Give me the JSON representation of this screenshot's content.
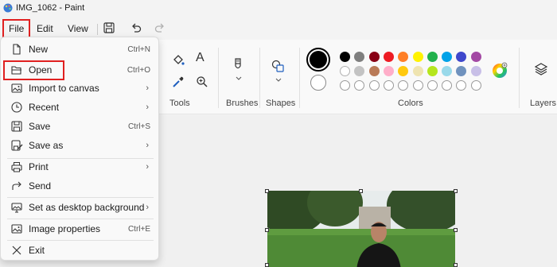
{
  "window": {
    "title": "IMG_1062 - Paint",
    "app_icon": "paint-palette-icon"
  },
  "menubar": {
    "file": "File",
    "edit": "Edit",
    "view": "View",
    "icons": [
      "save-icon",
      "undo-icon",
      "redo-icon"
    ]
  },
  "ribbon": {
    "tools_label": "Tools",
    "brushes_label": "Brushes",
    "shapes_label": "Shapes",
    "colors_label": "Colors",
    "layers_label": "Layers",
    "primary_color": "#000000",
    "secondary_color": "#ffffff",
    "palette_row1": [
      "#000000",
      "#7f7f7f",
      "#880015",
      "#ed1c24",
      "#ff7f27",
      "#fff200",
      "#22b14c",
      "#00a2e8",
      "#3f48cc",
      "#a349a4"
    ],
    "palette_row2": [
      "#ffffff",
      "#c3c3c3",
      "#b97a57",
      "#ffaec9",
      "#ffc90e",
      "#efe4b0",
      "#b5e61d",
      "#99d9ea",
      "#7092be",
      "#c8bfe7"
    ]
  },
  "file_menu": {
    "items": [
      {
        "label": "New",
        "shortcut": "Ctrl+N",
        "icon": "new-file-icon"
      },
      {
        "label": "Open",
        "shortcut": "Ctrl+O",
        "icon": "folder-open-icon"
      },
      {
        "label": "Import to canvas",
        "icon": "import-image-icon",
        "submenu": true
      },
      {
        "label": "Recent",
        "icon": "clock-icon",
        "submenu": true
      },
      {
        "label": "Save",
        "shortcut": "Ctrl+S",
        "icon": "save-icon"
      },
      {
        "label": "Save as",
        "icon": "save-as-icon",
        "submenu": true
      },
      {
        "label": "Print",
        "icon": "printer-icon",
        "submenu": true
      },
      {
        "label": "Send",
        "icon": "share-icon"
      },
      {
        "label": "Set as desktop background",
        "icon": "desktop-background-icon",
        "submenu": true
      },
      {
        "label": "Image properties",
        "shortcut": "Ctrl+E",
        "icon": "image-properties-icon"
      },
      {
        "label": "Exit",
        "icon": "close-icon"
      }
    ],
    "chevron": "›"
  }
}
